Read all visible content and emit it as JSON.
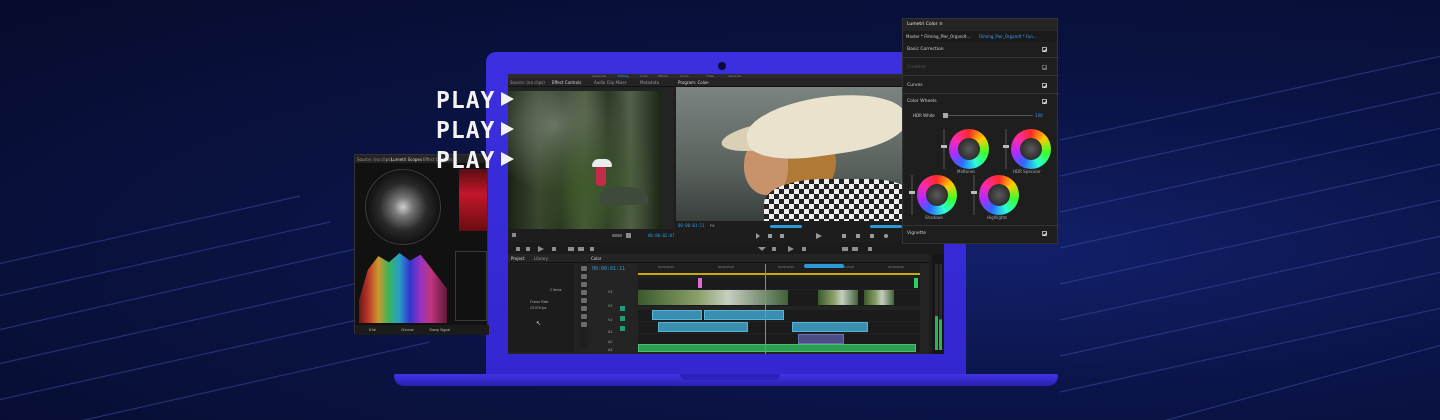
{
  "colors": {
    "background": "#0b1448",
    "laptop": "#3b2fe0",
    "accent_blue": "#2d9ad8",
    "audio_clip": "#2f9e55",
    "video_clip": "#4c4f86"
  },
  "headline": {
    "play_lines": [
      "PLAY",
      "PLAY",
      "PLAY"
    ],
    "arrow_icon": "play-triangle-icon"
  },
  "app": {
    "workspace_tabs": [
      "Assembly",
      "Editing",
      "Color",
      "Effects",
      "Audio",
      "Titles",
      "Libraries"
    ],
    "source_monitor": {
      "tabs": [
        "Source: (no clips)",
        "Effect Controls",
        "Audio Clip Mixer",
        "Metadata"
      ],
      "timecode": "00:00:02:07"
    },
    "program_monitor": {
      "tab": "Program: Color",
      "timecode": "00:00:01:11",
      "fit": "Fit"
    },
    "project": {
      "tabs": [
        "Project",
        "Library"
      ],
      "items": [
        "2 Items",
        "Frame Rate",
        "23.976 fps"
      ]
    },
    "timeline": {
      "tab": "Color",
      "timecode": "00:00:01:11",
      "ruler": [
        "00:00:00:00",
        "00:00:05:00",
        "00:00:10:00",
        "00:00:15:00",
        "00:00:20:00"
      ],
      "tracks": [
        "V3",
        "V2",
        "V1",
        "A1",
        "A2",
        "A3"
      ]
    },
    "scopes": {
      "tabs": [
        "Source: (no clips)",
        "Lumetri Scopes",
        "Effect Controls"
      ],
      "footer": [
        "8 bit",
        "Chroma",
        "Clamp Signal"
      ]
    }
  },
  "lumetri": {
    "title": "Lumetri Color",
    "master": "Master * Filming_Pier_Organdt...",
    "clip": "Filming_Pier_Organdt * Fun...",
    "sections": [
      "Basic Correction",
      "Creative",
      "Curves",
      "Color Wheels",
      "Vignette"
    ],
    "hdr_white": "HDR White",
    "hdr_white_value": "100",
    "wheels": [
      "Midtones",
      "HDR Specular",
      "Shadows",
      "Highlights"
    ]
  }
}
